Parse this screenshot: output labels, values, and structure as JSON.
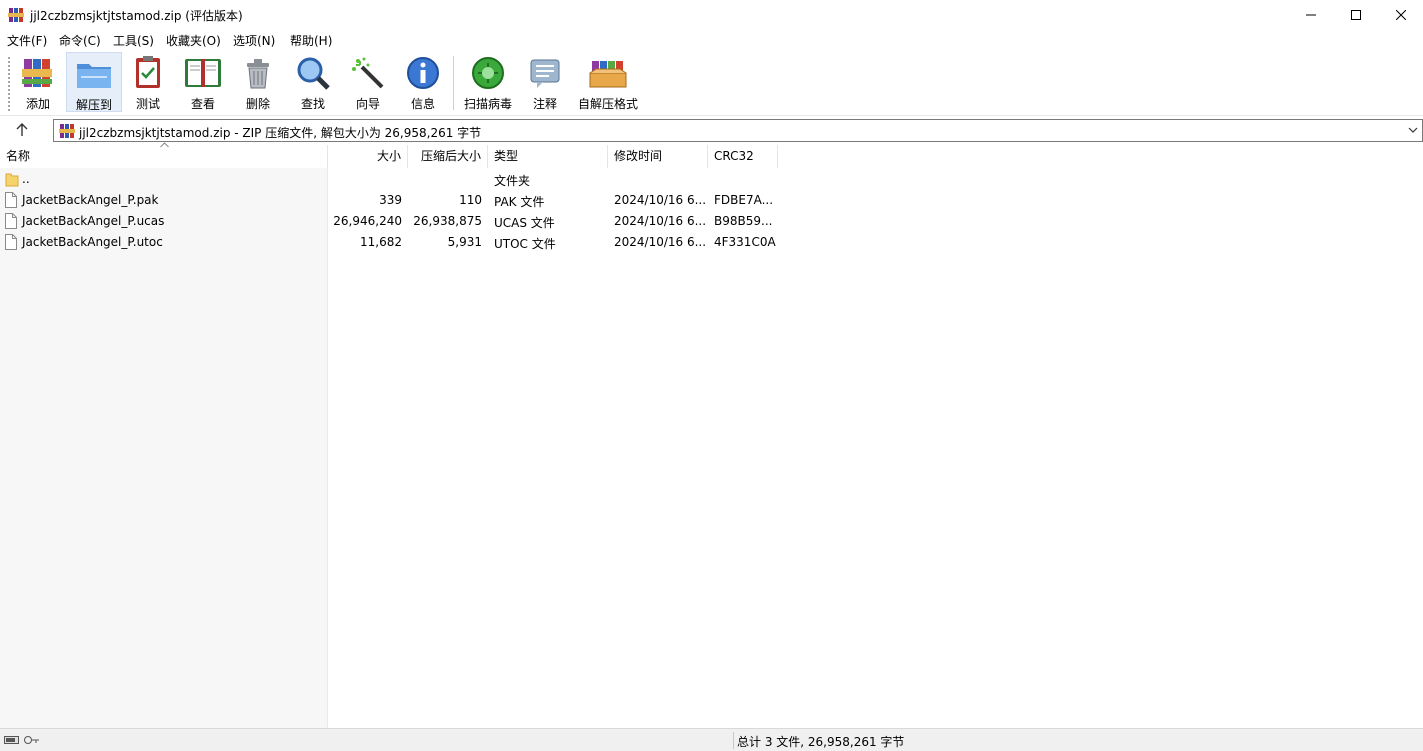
{
  "window": {
    "title": "jjl2czbzmsjktjtstamod.zip (评估版本)"
  },
  "menu": [
    "文件(F)",
    "命令(C)",
    "工具(S)",
    "收藏夹(O)",
    "选项(N)",
    "帮助(H)"
  ],
  "toolbar": {
    "buttons": [
      {
        "label": "添加",
        "icon": "add-archive-icon"
      },
      {
        "label": "解压到",
        "icon": "extract-folder-icon"
      },
      {
        "label": "测试",
        "icon": "test-clipboard-icon"
      },
      {
        "label": "查看",
        "icon": "view-book-icon"
      },
      {
        "label": "删除",
        "icon": "trash-icon"
      },
      {
        "label": "查找",
        "icon": "magnifier-icon"
      },
      {
        "label": "向导",
        "icon": "wizard-wand-icon"
      },
      {
        "label": "信息",
        "icon": "info-icon"
      },
      {
        "label": "扫描病毒",
        "icon": "virus-scan-icon"
      },
      {
        "label": "注释",
        "icon": "comment-icon"
      },
      {
        "label": "自解压格式",
        "icon": "sfx-box-icon"
      }
    ]
  },
  "address": {
    "text": "jjl2czbzmsjktjtstamod.zip - ZIP 压缩文件, 解包大小为 26,958,261 字节"
  },
  "columns": {
    "name": "名称",
    "size": "大小",
    "packed": "压缩后大小",
    "type": "类型",
    "modified": "修改时间",
    "crc": "CRC32"
  },
  "rows": [
    {
      "name": "..",
      "size": "",
      "packed": "",
      "type": "文件夹",
      "modified": "",
      "crc": "",
      "icon": "folder-icon"
    },
    {
      "name": "JacketBackAngel_P.pak",
      "size": "339",
      "packed": "110",
      "type": "PAK 文件",
      "modified": "2024/10/16 6...",
      "crc": "FDBE7A...",
      "icon": "file-icon"
    },
    {
      "name": "JacketBackAngel_P.ucas",
      "size": "26,946,240",
      "packed": "26,938,875",
      "type": "UCAS 文件",
      "modified": "2024/10/16 6...",
      "crc": "B98B59...",
      "icon": "file-icon"
    },
    {
      "name": "JacketBackAngel_P.utoc",
      "size": "11,682",
      "packed": "5,931",
      "type": "UTOC 文件",
      "modified": "2024/10/16 6...",
      "crc": "4F331C0A",
      "icon": "file-icon"
    }
  ],
  "status": {
    "total": "总计 3 文件, 26,958,261 字节"
  }
}
